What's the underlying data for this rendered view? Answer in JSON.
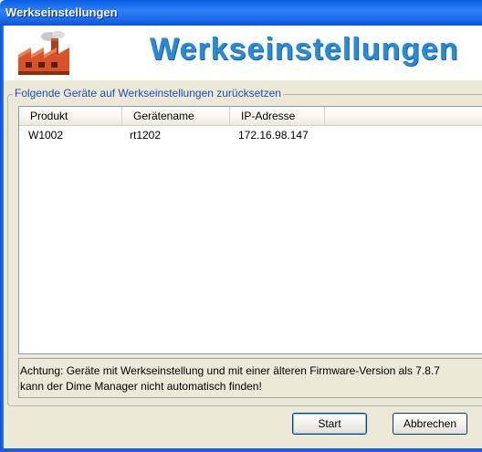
{
  "window": {
    "title": "Werkseinstellungen"
  },
  "header": {
    "banner_title": "Werkseinstellungen",
    "icon": "factory-icon"
  },
  "group": {
    "legend": "Folgende Geräte auf Werkseinstellungen zurücksetzen"
  },
  "table": {
    "columns": [
      "Produkt",
      "Gerätename",
      "IP-Adresse"
    ],
    "rows": [
      {
        "produkt": "W1002",
        "geraetename": "rt1202",
        "ip": "172.16.98.147"
      }
    ]
  },
  "notice": {
    "line1": "Achtung: Geräte mit Werkseinstellung und mit einer älteren Firmware-Version als 7.8.7",
    "line2": "kann der Dime Manager nicht automatisch finden!"
  },
  "buttons": {
    "start": "Start",
    "cancel": "Abbrechen"
  },
  "colors": {
    "titlebar": "#1d6ef0",
    "banner_text": "#2a8ad8",
    "legend_text": "#1c4db8",
    "factory": "#d9532a"
  }
}
